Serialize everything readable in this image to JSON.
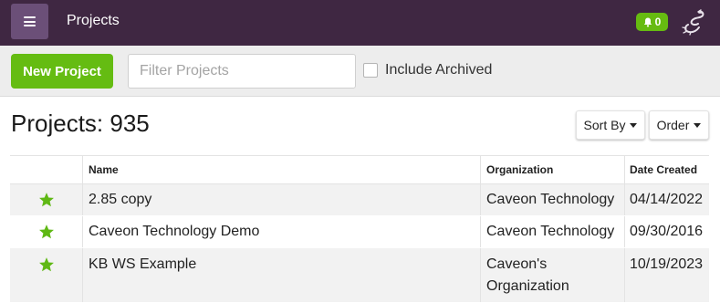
{
  "header": {
    "title": "Projects",
    "notification_count": "0",
    "accent": "#3f2742"
  },
  "toolbar": {
    "new_project_label": "New Project",
    "filter_placeholder": "Filter Projects",
    "include_archived_label": "Include Archived",
    "include_archived_checked": false
  },
  "main": {
    "heading": "Projects: 935",
    "sort_label": "Sort By",
    "order_label": "Order"
  },
  "table": {
    "columns": [
      "Name",
      "Organization",
      "Date Created"
    ],
    "rows": [
      {
        "starred": true,
        "name": "2.85 copy",
        "organization": "Caveon Technology",
        "date": "04/14/2022"
      },
      {
        "starred": true,
        "name": "Caveon Technology Demo",
        "organization": "Caveon Technology",
        "date": "09/30/2016"
      },
      {
        "starred": true,
        "name": "KB WS Example",
        "organization": "Caveon's Organization",
        "date": "10/19/2023"
      }
    ]
  },
  "icons": {
    "menu": "hamburger-menu-icon",
    "bell": "bell-icon",
    "logo": "scorpion-logo-icon",
    "star": "star-icon"
  },
  "colors": {
    "brand_green": "#65bc12",
    "star_green": "#5fb814",
    "menu_button": "#6b4f78"
  }
}
